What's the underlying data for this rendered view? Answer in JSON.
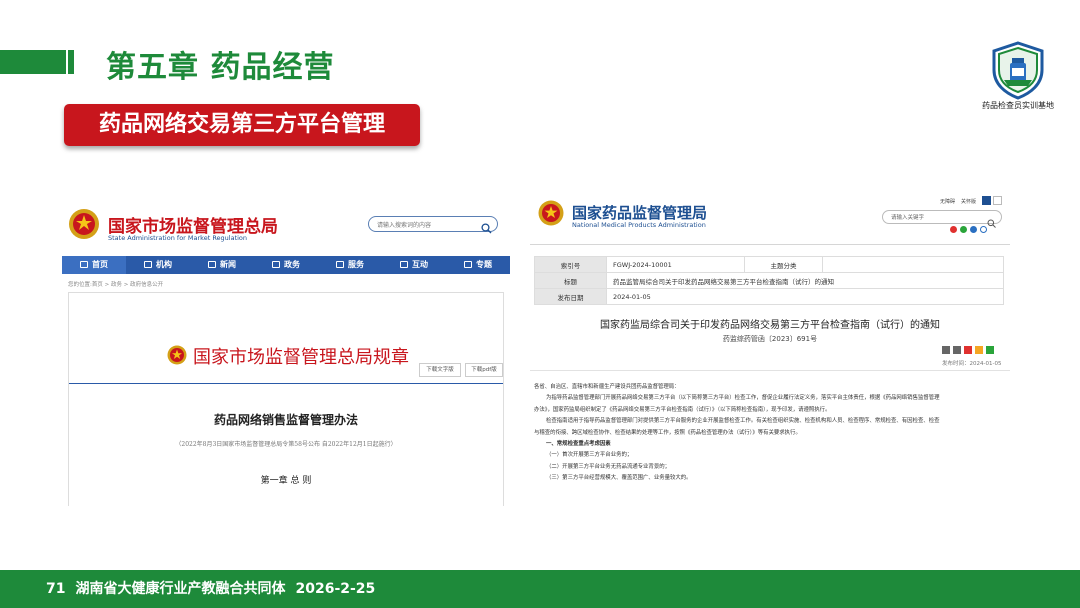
{
  "slide": {
    "chapter_title": "第五章 药品经营",
    "section_title": "药品网络交易第三方平台管理",
    "logo_caption": "药品检查员实训基地",
    "footer": {
      "page": "71",
      "org": "湖南省大健康行业产教融合共同体",
      "date": "2026-2-25"
    },
    "colors": {
      "green": "#1e8a3a",
      "red": "#c8161d"
    }
  },
  "left_page": {
    "site_name": "国家市场监督管理总局",
    "site_name_en": "State Administration for Market Regulation",
    "search_placeholder": "请输入搜索词的内容",
    "nav": [
      {
        "label": "首页",
        "icon": "home-icon"
      },
      {
        "label": "机构",
        "icon": "building-icon"
      },
      {
        "label": "新闻",
        "icon": "news-icon"
      },
      {
        "label": "政务",
        "icon": "gov-icon"
      },
      {
        "label": "服务",
        "icon": "service-icon"
      },
      {
        "label": "互动",
        "icon": "chat-icon"
      },
      {
        "label": "专题",
        "icon": "topic-icon"
      }
    ],
    "breadcrumb": "您的位置:首页 > 政务 > 政府信息公开",
    "regulation_heading": "国家市场监督管理总局规章",
    "download_text": "下载文字版",
    "download_pdf": "下载pdf版",
    "doc_title": "药品网络销售监督管理办法",
    "doc_note": "（2022年8月3日国家市场监督管理总局令第58号公布 自2022年12月1日起施行）",
    "chapter": "第一章 总 则"
  },
  "right_page": {
    "site_name": "国家药品监督管理局",
    "site_name_en": "National Medical Products Administration",
    "top_links": [
      "无障碍",
      "关怀版"
    ],
    "search_placeholder": "请输入关键字",
    "meta": {
      "index_label": "索引号",
      "index_value": "FGWJ-2024-10001",
      "topic_label": "主题分类",
      "topic_value": "",
      "title_label": "标题",
      "title_value": "药品监管局综合司关于印发药品网络交易第三方平台检查指南（试行）的通知",
      "date_label": "发布日期",
      "date_value": "2024-01-05"
    },
    "doc_title": "国家药监局综合司关于印发药品网络交易第三方平台检查指南（试行）的通知",
    "doc_number": "药监综药管函〔2023〕691号",
    "publish_time": "发布时间：2024-01-05",
    "body": [
      "各省、自治区、直辖市和新疆生产建设兵团药品监督管理局：",
      "为指导药品监督管理部门开展药品网络交易第三方平台（以下简称第三方平台）检查工作，督促企业履行法定义务，落实平台主体责任，根据《药品网络销售监督管理",
      "办法》，国家药监局组织制定了《药品网络交易第三方平台检查指南（试行）》（以下简称检查指南），现予印发，请遵照执行。",
      "检查指南适用于指导药品监督管理部门对提供第三方平台服务的企业开展监督检查工作。有关检查组织实施、检查机构和人员、检查程序、常规检查、有因检查、检查",
      "与稽查的衔接、跨区域检查协作、检查结果的处理等工作，按照《药品检查管理办法（试行）》等有关要求执行。",
      "一、常规检查重点考虑因素",
      "（一）首次开展第三方平台业务的；",
      "（二）开展第三方平台业务无药品流通专业背景的；",
      "（三）第三方平台经营规模大、覆盖范围广、业务量较大的。"
    ]
  }
}
